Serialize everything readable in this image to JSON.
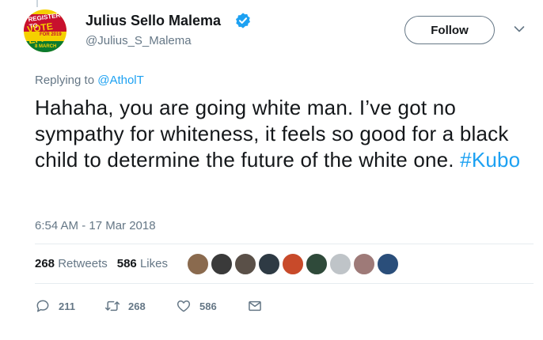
{
  "author": {
    "name": "Julius Sello Malema",
    "handle": "@Julius_S_Malema",
    "avatar_text": [
      "REGISTER TO",
      "VOTE EFF",
      "FOR 2019",
      "8 MARCH"
    ]
  },
  "follow_label": "Follow",
  "reply": {
    "prefix": "Replying to ",
    "mention": "@AtholT"
  },
  "tweet": {
    "text": "Hahaha, you are going white man. I’ve got no sympathy for whiteness, it feels so good for a black child to determine the future of the white one. ",
    "hashtag": "#Kubo"
  },
  "timestamp": "6:54 AM - 17 Mar 2018",
  "stats": {
    "retweets_count": "268",
    "retweets_label": "Retweets",
    "likes_count": "586",
    "likes_label": "Likes"
  },
  "liker_avatar_colors": [
    "#8a6a4e",
    "#3a3a3a",
    "#5a5048",
    "#2e3a44",
    "#c84a2a",
    "#2f4a3a",
    "#bfc4c8",
    "#9e7a78",
    "#2a4e7a"
  ],
  "actions": {
    "reply_count": "211",
    "retweet_count": "268",
    "like_count": "586"
  },
  "colors": {
    "link": "#1da1f2",
    "muted": "#657786",
    "text": "#14171a",
    "verified": "#1da1f2"
  },
  "icons": [
    "verified-icon",
    "chevron-down-icon",
    "reply-icon",
    "retweet-icon",
    "heart-icon",
    "message-icon"
  ]
}
